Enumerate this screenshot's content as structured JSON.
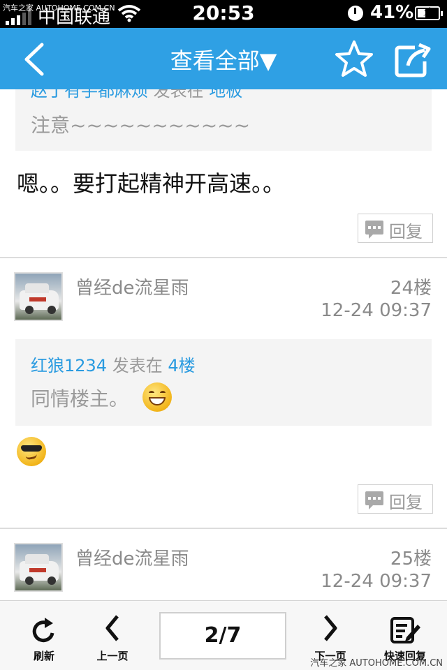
{
  "status_bar": {
    "watermark": "汽车之家 AUTOHOME.COM.CN",
    "carrier": "中国联通",
    "time": "20:53",
    "battery": "41%",
    "battery_level": 0.41
  },
  "nav": {
    "title": "查看全部▼"
  },
  "posts": [
    {
      "quote_meta_prefix": "赵丁有手都麻烦",
      "quote_meta_mid": " 发表在 ",
      "quote_meta_suffix": "地板",
      "quote_text": "注意~~~~~~~~~~~",
      "body": "嗯。。要打起精神开高速。。",
      "reply": "回复"
    },
    {
      "user": "曾经de流星雨",
      "floor": "24楼",
      "time": "12-24 09:37",
      "quote_meta_prefix": "红狼1234",
      "quote_meta_mid": " 发表在 ",
      "quote_meta_suffix": "4楼",
      "quote_text": "同情楼主。",
      "quote_emoji": "grin-emoji",
      "body_emoji": "cool-sunglasses-emoji",
      "reply": "回复"
    },
    {
      "user": "曾经de流星雨",
      "floor": "25楼",
      "time": "12-24 09:37"
    }
  ],
  "toolbar": {
    "refresh": "刷新",
    "prev": "上一页",
    "page": "2/7",
    "next": "下一页",
    "quick_reply": "快速回复",
    "watermark": "汽车之家 AUTOHOME.COM.CN"
  },
  "colors": {
    "nav_blue": "#2fa0e4",
    "link_blue": "#2a9be0"
  }
}
